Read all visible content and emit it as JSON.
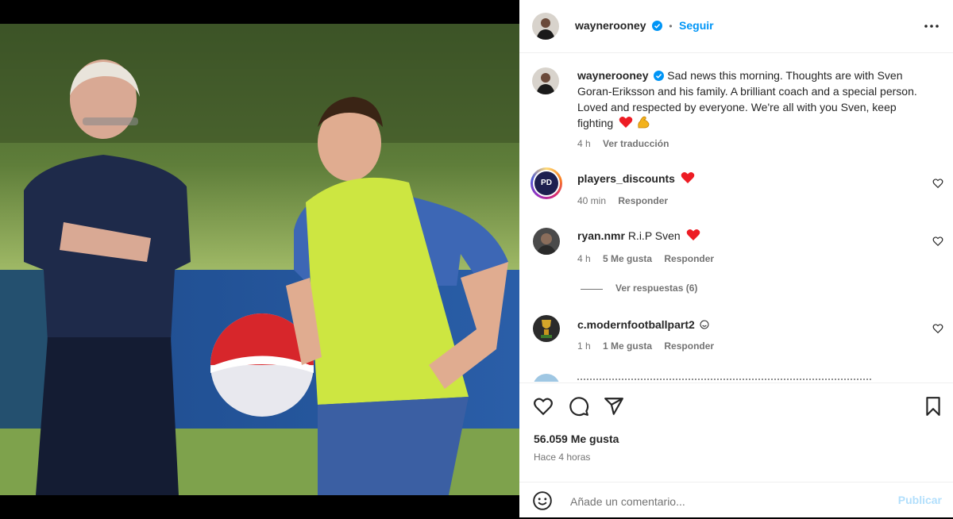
{
  "post": {
    "author": "waynerooney",
    "follow_label": "Seguir",
    "dot": "•",
    "caption": "Sad news this morning. Thoughts are with Sven Goran-Eriksson and his family. A brilliant coach and a special person. Loved and respected by everyone. We're all with you Sven, keep fighting",
    "caption_time": "4 h",
    "translate_label": "Ver traducción",
    "likes": "56.059 Me gusta",
    "posted_ago": "Hace 4 horas"
  },
  "comments": [
    {
      "user": "players_discounts",
      "text": "",
      "time": "40 min",
      "likes": "",
      "reply": "Responder",
      "avatar_text": "PD"
    },
    {
      "user": "ryan.nmr",
      "text": "R.i.P Sven",
      "time": "4 h",
      "likes": "5 Me gusta",
      "reply": "Responder"
    },
    {
      "user": "c.modernfootballpart2",
      "text": "",
      "time": "1 h",
      "likes": "1 Me gusta",
      "reply": "Responder"
    }
  ],
  "replies_label": "Ver respuestas (6)",
  "add_comment": {
    "placeholder": "Añade un comentario...",
    "publish_label": "Publicar"
  },
  "icons": {
    "more": "more-horizontal-icon",
    "like": "heart-icon",
    "comment": "comment-icon",
    "share": "share-icon",
    "save": "bookmark-icon",
    "emoji": "emoji-icon"
  },
  "colors": {
    "accent": "#0095f6",
    "muted": "#737373",
    "heart_red": "#ed1c24",
    "publish_disabled": "#b2dffc"
  }
}
